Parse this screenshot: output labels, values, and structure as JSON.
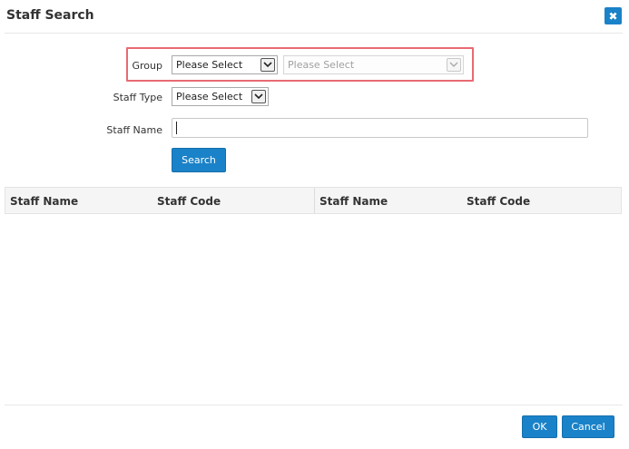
{
  "dialog": {
    "title": "Staff Search",
    "close_icon": "close-icon"
  },
  "form": {
    "group_label": "Group",
    "group_select_value": "Please Select",
    "subgroup_select_value": "Please Select",
    "staff_type_label": "Staff Type",
    "staff_type_value": "Please Select",
    "staff_name_label": "Staff Name",
    "staff_name_value": "",
    "search_button": "Search"
  },
  "results_table": {
    "columns": [
      "Staff Name",
      "Staff Code",
      "Staff Name",
      "Staff Code"
    ],
    "rows": []
  },
  "footer": {
    "ok_button": "OK",
    "cancel_button": "Cancel"
  },
  "colors": {
    "accent": "#1a82c8",
    "highlight_border": "#e96a72"
  }
}
